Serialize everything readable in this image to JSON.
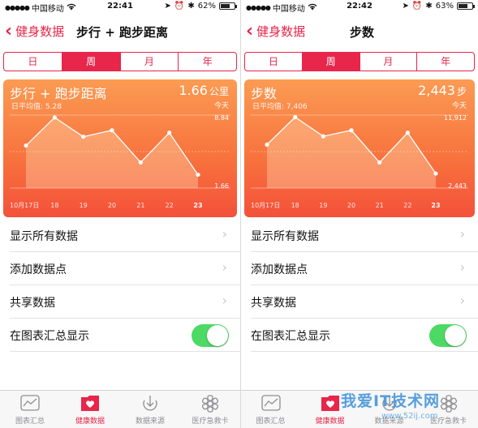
{
  "colors": {
    "accent": "#e8254a",
    "toggle_on": "#4cd964",
    "chart_top": "#fb9b53",
    "chart_bottom": "#f4513a"
  },
  "panels": [
    {
      "status": {
        "carrier": "中国移动",
        "time": "22:41",
        "battery": "62%",
        "battery_level": 0.62
      },
      "nav": {
        "back_label": "健身数据",
        "title": "步行 + 跑步距离"
      },
      "segments": [
        "日",
        "周",
        "月",
        "年"
      ],
      "selected_segment": "周",
      "card": {
        "title": "步行 + 跑步距离",
        "daily_avg": "日平均值: 5.28",
        "value": "1.66",
        "unit": "公里",
        "today": "今天",
        "max_label": "8.84",
        "min_label": "1.66"
      },
      "rows": [
        "显示所有数据",
        "添加数据点",
        "共享数据",
        "在图表汇总显示"
      ],
      "tabs": [
        {
          "label": "图表汇总",
          "icon": "chart-icon"
        },
        {
          "label": "健康数据",
          "icon": "health-data-icon"
        },
        {
          "label": "数据来源",
          "icon": "data-source-icon"
        },
        {
          "label": "医疗急救卡",
          "icon": "medical-id-icon"
        }
      ],
      "chart_data": {
        "type": "line",
        "x": [
          "10月17日",
          "18",
          "19",
          "20",
          "21",
          "22",
          "23"
        ],
        "values": [
          5.3,
          8.8,
          6.4,
          7.2,
          3.2,
          6.9,
          1.66
        ],
        "ylim": [
          0,
          9.5
        ],
        "grid": true
      }
    },
    {
      "status": {
        "carrier": "中国移动",
        "time": "22:42",
        "battery": "63%",
        "battery_level": 0.63
      },
      "nav": {
        "back_label": "健身数据",
        "title": "步数"
      },
      "segments": [
        "日",
        "周",
        "月",
        "年"
      ],
      "selected_segment": "周",
      "card": {
        "title": "步数",
        "daily_avg": "日平均值: 7,406",
        "value": "2,443",
        "unit": "步",
        "today": "今天",
        "max_label": "11,912",
        "min_label": "2,443"
      },
      "rows": [
        "显示所有数据",
        "添加数据点",
        "共享数据",
        "在图表汇总显示"
      ],
      "tabs": [
        {
          "label": "图表汇总",
          "icon": "chart-icon"
        },
        {
          "label": "健康数据",
          "icon": "health-data-icon"
        },
        {
          "label": "数据来源",
          "icon": "data-source-icon"
        },
        {
          "label": "医疗急救卡",
          "icon": "medical-id-icon"
        }
      ],
      "chart_data": {
        "type": "line",
        "x": [
          "10月17日",
          "18",
          "19",
          "20",
          "21",
          "22",
          "23"
        ],
        "values": [
          7300,
          11912,
          8700,
          9700,
          4300,
          9300,
          2443
        ],
        "ylim": [
          0,
          12800
        ],
        "grid": true
      }
    }
  ],
  "watermark": {
    "text": "我爱IT技术网",
    "url": "www.52ij.com"
  }
}
